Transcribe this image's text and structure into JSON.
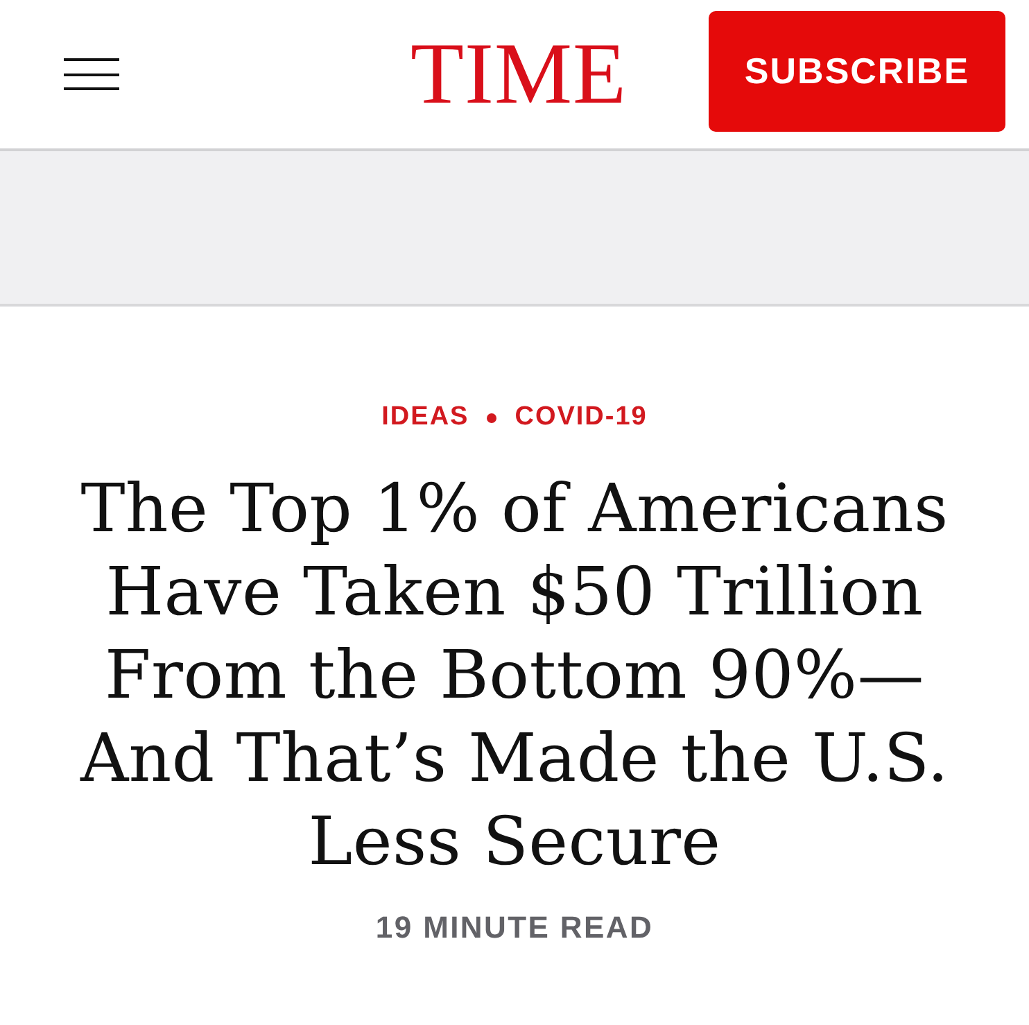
{
  "header": {
    "logo": "TIME",
    "subscribe_button": "SUBSCRIBE"
  },
  "article": {
    "section_tags": [
      "IDEAS",
      "COVID-19"
    ],
    "headline": "The Top 1% of Americans Have Taken $50 Trillion From the Bottom 90%—And That’s Made the U.S. Less Secure",
    "read_time": "19 MINUTE READ"
  }
}
